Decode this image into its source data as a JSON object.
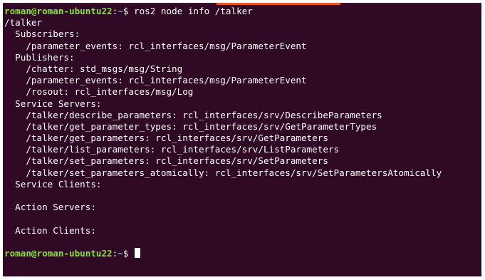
{
  "terminal": {
    "background": "#300a24",
    "prompt": {
      "user_host": "roman@roman-ubuntu22",
      "separator": ":",
      "path": "~",
      "symbol": "$ ",
      "user_color": "#8ae234",
      "path_color": "#729fcf"
    },
    "command": "ros2 node info /talker",
    "output": [
      "/talker",
      "  Subscribers:",
      "    /parameter_events: rcl_interfaces/msg/ParameterEvent",
      "  Publishers:",
      "    /chatter: std_msgs/msg/String",
      "    /parameter_events: rcl_interfaces/msg/ParameterEvent",
      "    /rosout: rcl_interfaces/msg/Log",
      "  Service Servers:",
      "    /talker/describe_parameters: rcl_interfaces/srv/DescribeParameters",
      "    /talker/get_parameter_types: rcl_interfaces/srv/GetParameterTypes",
      "    /talker/get_parameters: rcl_interfaces/srv/GetParameters",
      "    /talker/list_parameters: rcl_interfaces/srv/ListParameters",
      "    /talker/set_parameters: rcl_interfaces/srv/SetParameters",
      "    /talker/set_parameters_atomically: rcl_interfaces/srv/SetParametersAtomically",
      "  Service Clients:",
      "",
      "  Action Servers:",
      "",
      "  Action Clients:",
      ""
    ]
  }
}
